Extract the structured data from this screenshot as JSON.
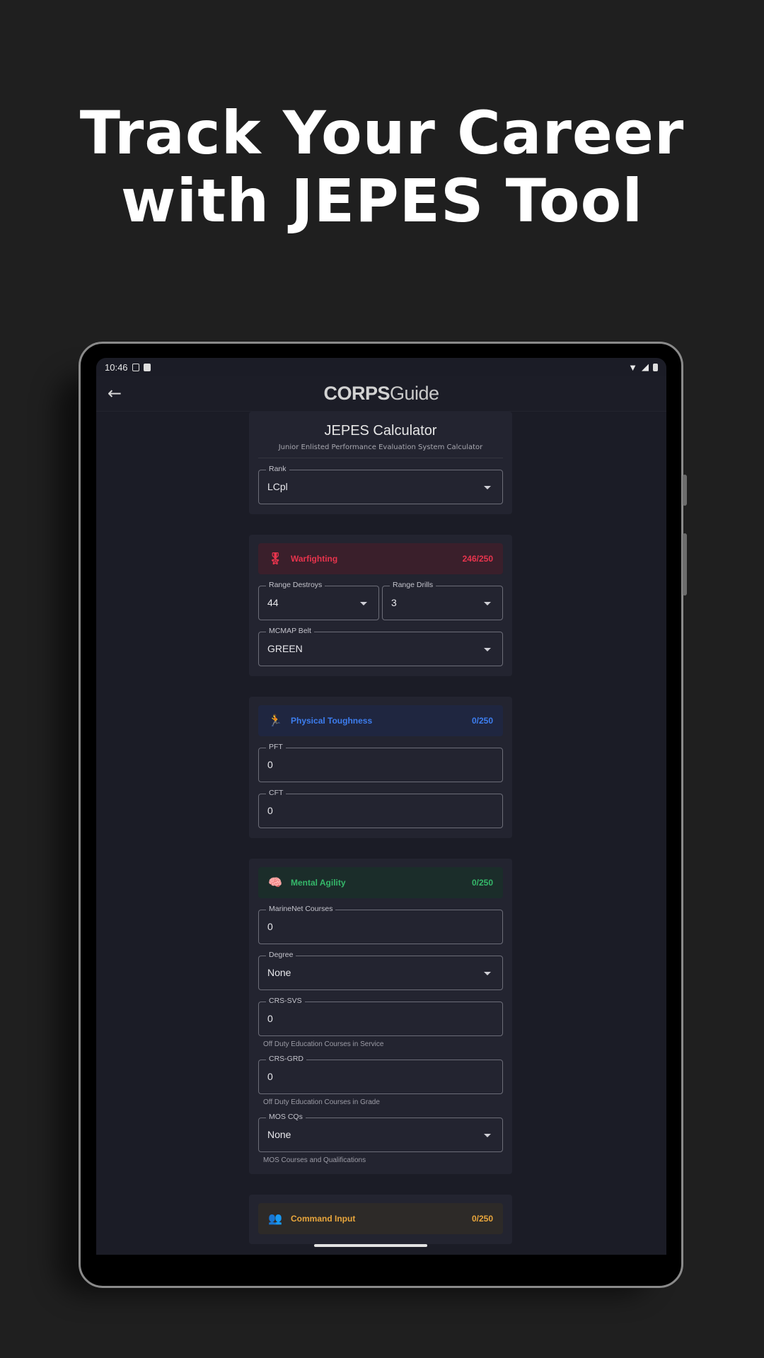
{
  "headline": {
    "line1": "Track Your Career",
    "line2": "with JEPES Tool"
  },
  "status_bar": {
    "time": "10:46"
  },
  "app_bar": {
    "logo_bold": "CORPS",
    "logo_regular": "Guide",
    "back_icon": "arrow-left-icon"
  },
  "calculator": {
    "title": "JEPES Calculator",
    "subtitle": "Junior Enlisted Performance Evaluation System Calculator",
    "rank": {
      "label": "Rank",
      "value": "LCpl"
    }
  },
  "warfighting": {
    "icon": "medal-icon",
    "title": "Warfighting",
    "score": "246/250",
    "color": "#e8344d",
    "range_destroys": {
      "label": "Range Destroys",
      "value": "44"
    },
    "range_drills": {
      "label": "Range Drills",
      "value": "3"
    },
    "mcmap_belt": {
      "label": "MCMAP Belt",
      "value": "GREEN"
    }
  },
  "physical": {
    "icon": "running-icon",
    "title": "Physical Toughness",
    "score": "0/250",
    "color": "#3d7ef0",
    "pft": {
      "label": "PFT",
      "value": "0"
    },
    "cft": {
      "label": "CFT",
      "value": "0"
    }
  },
  "mental": {
    "icon": "brain-icon",
    "title": "Mental Agility",
    "score": "0/250",
    "color": "#35b86a",
    "marinenet": {
      "label": "MarineNet Courses",
      "value": "0"
    },
    "degree": {
      "label": "Degree",
      "value": "None"
    },
    "crs_svs": {
      "label": "CRS-SVS",
      "value": "0",
      "helper": "Off Duty Education Courses in Service"
    },
    "crs_grd": {
      "label": "CRS-GRD",
      "value": "0",
      "helper": "Off Duty Education Courses in Grade"
    },
    "mos_cqs": {
      "label": "MOS CQs",
      "value": "None",
      "helper": "MOS Courses and Qualifications"
    }
  },
  "command": {
    "icon": "group-icon",
    "title": "Command Input",
    "score": "0/250",
    "color": "#e9a63c"
  }
}
